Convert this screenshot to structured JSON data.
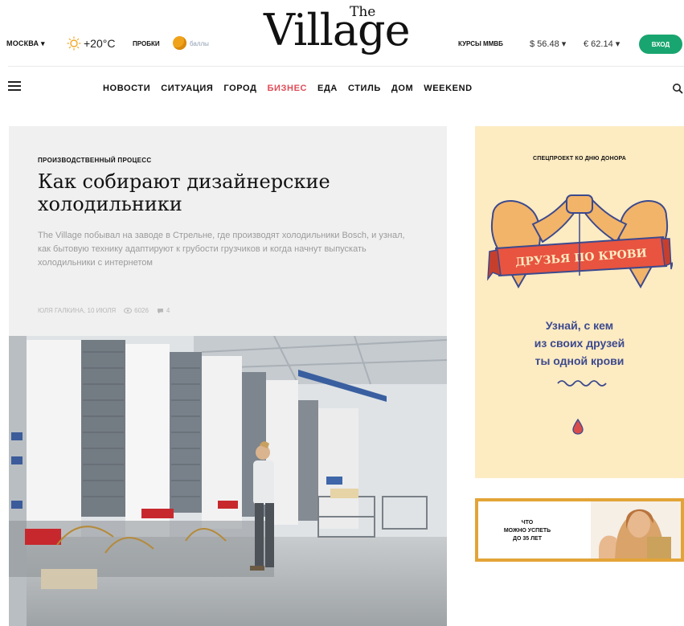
{
  "header": {
    "city": "МОСКВА",
    "city_caret": "▾",
    "temperature": "+20°C",
    "traffic_label": "ПРОБКИ",
    "traffic_score": "баллы",
    "logo_main": "Village",
    "logo_the": "The",
    "rates_label": "КУРСЫ ММВБ",
    "usd_rate": "$ 56.48 ▾",
    "eur_rate": "€ 62.14 ▾",
    "login_label": "ВХОД"
  },
  "nav": {
    "items": [
      {
        "label": "НОВОСТИ",
        "active": false
      },
      {
        "label": "СИТУАЦИЯ",
        "active": false
      },
      {
        "label": "ГОРОД",
        "active": false
      },
      {
        "label": "БИЗНЕС",
        "active": true
      },
      {
        "label": "ЕДА",
        "active": false
      },
      {
        "label": "СТИЛЬ",
        "active": false
      },
      {
        "label": "ДОМ",
        "active": false
      },
      {
        "label": "WEEKEND",
        "active": false
      }
    ],
    "icons": [
      "menu-icon",
      "search-icon"
    ]
  },
  "story": {
    "rubric": "ПРОИЗВОДСТВЕННЫЙ ПРОЦЕСС",
    "headline": "Как собирают дизайнерские холодильники",
    "lead": "The Village побывал на заводе в Стрельне, где производят холодильники Bosch, и узнал, как бытовую технику адаптируют к грубости грузчиков и когда начнут выпускать холодильники с интернетом",
    "author_date": "ЮЛЯ ГАЛКИНА, 10 ИЮЛЯ",
    "views": "6026",
    "comments": "4"
  },
  "ads": {
    "donor": {
      "top_label": "СПЕЦПРОЕКТ КО ДНЮ ДОНОРА",
      "ribbon": "ДРУЗЬЯ ПО КРОВИ",
      "line1": "Узнай, с кем",
      "line2": "из своих друзей",
      "line3": "ты одной крови"
    },
    "age": {
      "line1": "ЧТО",
      "line2": "МОЖНО УСПЕТЬ",
      "line3": "ДО 35 ЛЕТ"
    }
  },
  "colors": {
    "accent_active": "#e04c57",
    "login_green": "#19a56f",
    "ad_bg": "#fdebc2",
    "ad_text": "#3c4a8e",
    "ad_border": "#e3a437"
  }
}
